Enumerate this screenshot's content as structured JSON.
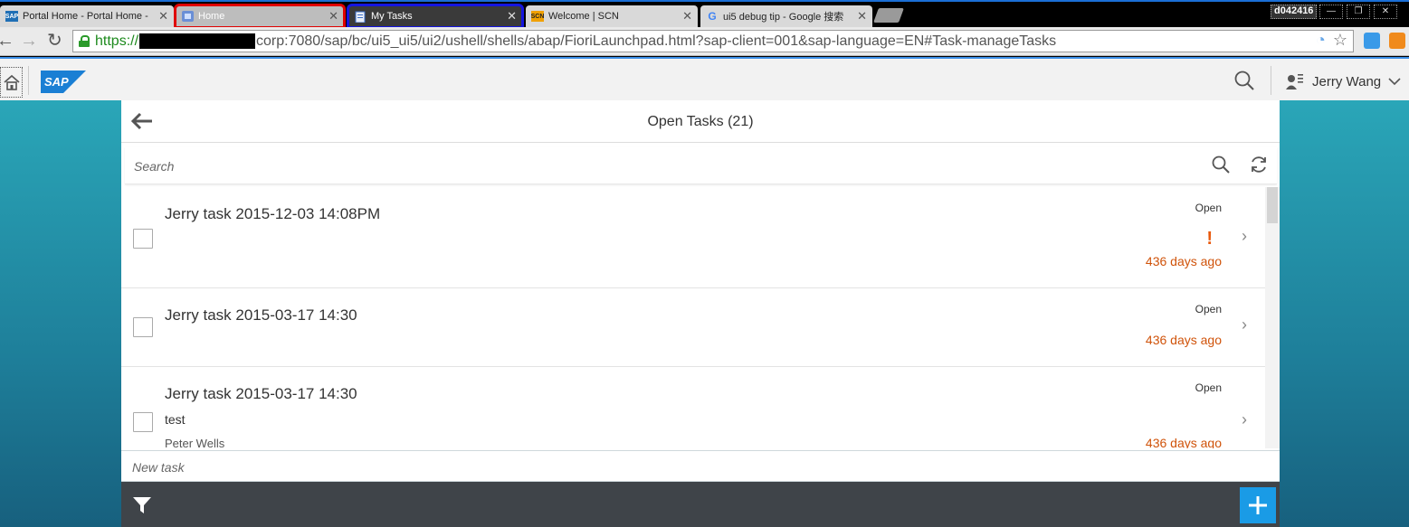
{
  "browser": {
    "tabs": [
      {
        "title": "Portal Home - Portal Home -",
        "favicon": "SAP"
      },
      {
        "title": "Home",
        "favicon": ""
      },
      {
        "title": "My Tasks",
        "favicon": ""
      },
      {
        "title": "Welcome | SCN",
        "favicon": "SCN"
      },
      {
        "title": "ui5 debug tip - Google 搜索",
        "favicon": "G"
      }
    ],
    "profile": "d042416",
    "url": {
      "scheme": "https://",
      "rest": "corp:7080/sap/bc/ui5_ui5/ui2/ushell/shells/abap/FioriLaunchpad.html?sap-client=001&sap-language=EN#Task-manageTasks"
    }
  },
  "shell": {
    "logo": "SAP",
    "user_name": "Jerry Wang"
  },
  "page": {
    "title": "Open Tasks (21)",
    "search_placeholder": "Search",
    "new_task_placeholder": "New task"
  },
  "tasks": [
    {
      "title": "Jerry task 2015-12-03 14:08PM",
      "status": "Open",
      "priority": "!",
      "due": "436 days ago",
      "description": "",
      "assignee": ""
    },
    {
      "title": "Jerry task 2015-03-17 14:30",
      "status": "Open",
      "priority": "",
      "due": "436 days ago",
      "description": "",
      "assignee": ""
    },
    {
      "title": "Jerry task 2015-03-17 14:30",
      "status": "Open",
      "priority": "",
      "due": "436 days ago",
      "description": "test",
      "assignee": "Peter Wells"
    }
  ],
  "colors": {
    "accent": "#1a9be6",
    "due_overdue": "#d0530a",
    "priority_high": "#e8590c",
    "footer": "#3f4449"
  }
}
